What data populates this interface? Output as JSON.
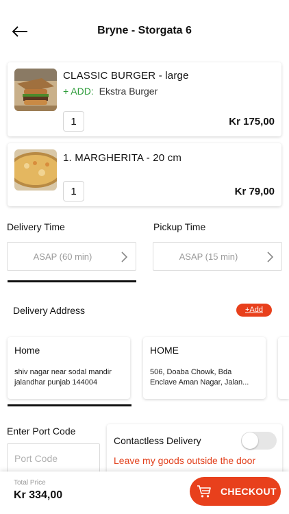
{
  "header": {
    "title": "Bryne - Storgata 6",
    "back_icon": "arrow-left-icon"
  },
  "cart": {
    "items": [
      {
        "name": "CLASSIC BURGER - large",
        "addon_label": "+ ADD:",
        "addon_value": "Ekstra Burger",
        "qty": "1",
        "price": "Kr 175,00"
      },
      {
        "name": "1. MARGHERITA - 20 cm",
        "qty": "1",
        "price": "Kr 79,00"
      }
    ]
  },
  "delivery_time": {
    "label": "Delivery Time",
    "value": "ASAP (60 min)"
  },
  "pickup_time": {
    "label": "Pickup Time",
    "value": "ASAP (15 min)"
  },
  "address": {
    "label": "Delivery Address",
    "add_label": "+Add",
    "cards": [
      {
        "name": "Home",
        "line1": "shiv nagar near sodal mandir",
        "line2": "jalandhar punjab 144004"
      },
      {
        "name": "HOME",
        "line1": "506, Doaba Chowk, Bda",
        "line2": "Enclave Aman Nagar, Jalan..."
      }
    ]
  },
  "port_code": {
    "label": "Enter Port Code",
    "placeholder": "Port Code"
  },
  "contactless": {
    "title": "Contactless Delivery",
    "note": "Leave my goods outside the door",
    "enabled": false
  },
  "footer": {
    "total_label": "Total Price",
    "total_value": "Kr 334,00",
    "checkout_label": "CHECKOUT"
  },
  "colors": {
    "accent": "#e8401c",
    "addon_green": "#2e9c3a",
    "note_red": "#e2401c"
  }
}
